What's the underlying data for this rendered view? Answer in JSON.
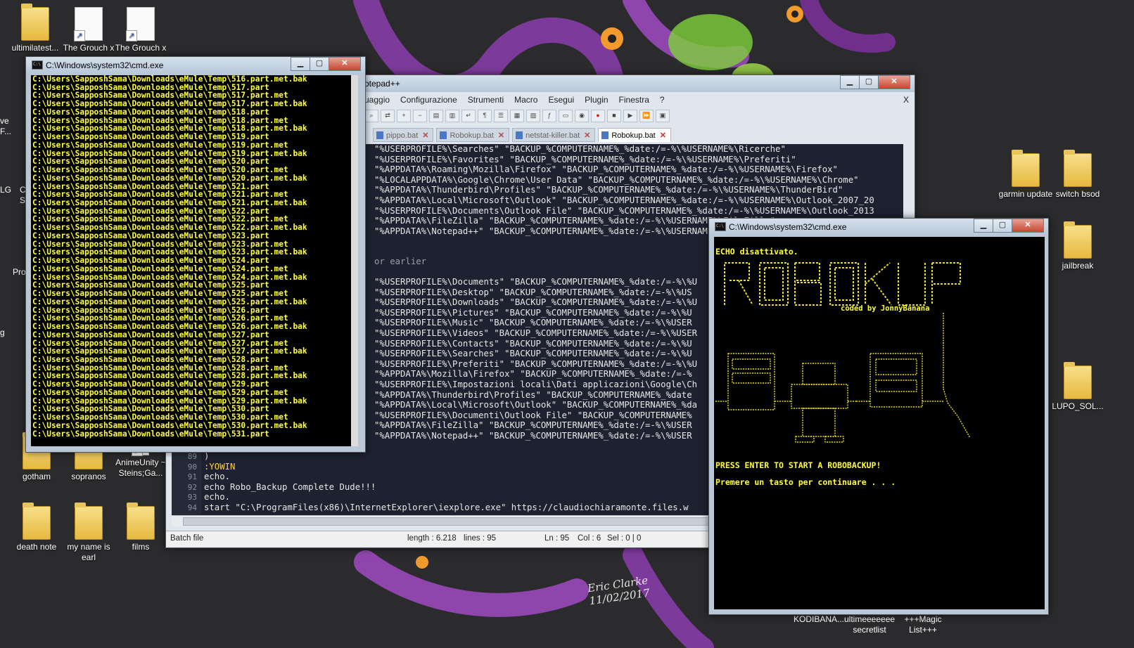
{
  "desktop": {
    "icons_left": [
      {
        "label": "ultimilatest...",
        "type": "folder"
      },
      {
        "label": "The Grouch x",
        "type": "doc"
      },
      {
        "label": "The Grouch x",
        "type": "doc"
      },
      {
        "label": "gotham",
        "type": "folder"
      },
      {
        "label": "sopranos",
        "type": "folder"
      },
      {
        "label": "AnimeUnity ~ Steins;Ga...",
        "type": "doc"
      },
      {
        "label": "death note",
        "type": "folder"
      },
      {
        "label": "my name is earl",
        "type": "folder"
      },
      {
        "label": "films",
        "type": "folder"
      }
    ],
    "edge_labels": [
      "ve",
      "F...",
      "LG",
      "C",
      "S",
      "Pro",
      "g"
    ],
    "icons_right": [
      {
        "label": "garmin update",
        "type": "folder"
      },
      {
        "label": "switch bsod",
        "type": "folder"
      },
      {
        "label": "jailbreak",
        "type": "folder"
      },
      {
        "label": "LUPO_SOL...",
        "type": "folder"
      }
    ],
    "bottom_labels": [
      "KODIBANA...",
      "ultimeeeeeee secretlist",
      "+++Magic List+++"
    ],
    "signature": "Eric Clarke 11/02/2017"
  },
  "cmd1": {
    "title": "C:\\Windows\\system32\\cmd.exe",
    "lines": [
      "C:\\Users\\SapposhSama\\Downloads\\eMule\\Temp\\516.part.met.bak",
      "C:\\Users\\SapposhSama\\Downloads\\eMule\\Temp\\517.part",
      "C:\\Users\\SapposhSama\\Downloads\\eMule\\Temp\\517.part.met",
      "C:\\Users\\SapposhSama\\Downloads\\eMule\\Temp\\517.part.met.bak",
      "C:\\Users\\SapposhSama\\Downloads\\eMule\\Temp\\518.part",
      "C:\\Users\\SapposhSama\\Downloads\\eMule\\Temp\\518.part.met",
      "C:\\Users\\SapposhSama\\Downloads\\eMule\\Temp\\518.part.met.bak",
      "C:\\Users\\SapposhSama\\Downloads\\eMule\\Temp\\519.part",
      "C:\\Users\\SapposhSama\\Downloads\\eMule\\Temp\\519.part.met",
      "C:\\Users\\SapposhSama\\Downloads\\eMule\\Temp\\519.part.met.bak",
      "C:\\Users\\SapposhSama\\Downloads\\eMule\\Temp\\520.part",
      "C:\\Users\\SapposhSama\\Downloads\\eMule\\Temp\\520.part.met",
      "C:\\Users\\SapposhSama\\Downloads\\eMule\\Temp\\520.part.met.bak",
      "C:\\Users\\SapposhSama\\Downloads\\eMule\\Temp\\521.part",
      "C:\\Users\\SapposhSama\\Downloads\\eMule\\Temp\\521.part.met",
      "C:\\Users\\SapposhSama\\Downloads\\eMule\\Temp\\521.part.met.bak",
      "C:\\Users\\SapposhSama\\Downloads\\eMule\\Temp\\522.part",
      "C:\\Users\\SapposhSama\\Downloads\\eMule\\Temp\\522.part.met",
      "C:\\Users\\SapposhSama\\Downloads\\eMule\\Temp\\522.part.met.bak",
      "C:\\Users\\SapposhSama\\Downloads\\eMule\\Temp\\523.part",
      "C:\\Users\\SapposhSama\\Downloads\\eMule\\Temp\\523.part.met",
      "C:\\Users\\SapposhSama\\Downloads\\eMule\\Temp\\523.part.met.bak",
      "C:\\Users\\SapposhSama\\Downloads\\eMule\\Temp\\524.part",
      "C:\\Users\\SapposhSama\\Downloads\\eMule\\Temp\\524.part.met",
      "C:\\Users\\SapposhSama\\Downloads\\eMule\\Temp\\524.part.met.bak",
      "C:\\Users\\SapposhSama\\Downloads\\eMule\\Temp\\525.part",
      "C:\\Users\\SapposhSama\\Downloads\\eMule\\Temp\\525.part.met",
      "C:\\Users\\SapposhSama\\Downloads\\eMule\\Temp\\525.part.met.bak",
      "C:\\Users\\SapposhSama\\Downloads\\eMule\\Temp\\526.part",
      "C:\\Users\\SapposhSama\\Downloads\\eMule\\Temp\\526.part.met",
      "C:\\Users\\SapposhSama\\Downloads\\eMule\\Temp\\526.part.met.bak",
      "C:\\Users\\SapposhSama\\Downloads\\eMule\\Temp\\527.part",
      "C:\\Users\\SapposhSama\\Downloads\\eMule\\Temp\\527.part.met",
      "C:\\Users\\SapposhSama\\Downloads\\eMule\\Temp\\527.part.met.bak",
      "C:\\Users\\SapposhSama\\Downloads\\eMule\\Temp\\528.part",
      "C:\\Users\\SapposhSama\\Downloads\\eMule\\Temp\\528.part.met",
      "C:\\Users\\SapposhSama\\Downloads\\eMule\\Temp\\528.part.met.bak",
      "C:\\Users\\SapposhSama\\Downloads\\eMule\\Temp\\529.part",
      "C:\\Users\\SapposhSama\\Downloads\\eMule\\Temp\\529.part.met",
      "C:\\Users\\SapposhSama\\Downloads\\eMule\\Temp\\529.part.met.bak",
      "C:\\Users\\SapposhSama\\Downloads\\eMule\\Temp\\530.part",
      "C:\\Users\\SapposhSama\\Downloads\\eMule\\Temp\\530.part.met",
      "C:\\Users\\SapposhSama\\Downloads\\eMule\\Temp\\530.part.met.bak",
      "C:\\Users\\SapposhSama\\Downloads\\eMule\\Temp\\531.part"
    ]
  },
  "notepad": {
    "title": "otepad++",
    "menu": [
      "uaggio",
      "Configurazione",
      "Strumenti",
      "Macro",
      "Esegui",
      "Plugin",
      "Finestra",
      "?",
      "X"
    ],
    "tabs": [
      {
        "label": "pippo.bat",
        "active": false
      },
      {
        "label": "Robokup.bat",
        "active": false
      },
      {
        "label": "netstat-killer.bat",
        "active": false
      },
      {
        "label": "Robokup.bat",
        "active": true
      }
    ],
    "code_top": [
      "\"%USERPROFILE%\\Searches\" \"BACKUP_%COMPUTERNAME%_%date:/=-%\\%USERNAME%\\Ricerche\"",
      "\"%USERPROFILE%\\Favorites\" \"BACKUP_%COMPUTERNAME%_%date:/=-%\\%USERNAME%\\Preferiti\"",
      "\"%APPDATA%\\Roaming\\Mozilla\\Firefox\" \"BACKUP_%COMPUTERNAME%_%date:/=-%\\%USERNAME%\\Firefox\"",
      "\"%LOCALAPPDATA%\\Google\\Chrome\\User Data\" \"BACKUP_%COMPUTERNAME%_%date:/=-%\\%USERNAME%\\Chrome\"",
      "\"%APPDATA%\\Thunderbird\\Profiles\" \"BACKUP_%COMPUTERNAME%_%date:/=-%\\%USERNAME%\\ThunderBird\"",
      "\"%APPDATA%\\Local\\Microsoft\\Outlook\" \"BACKUP_%COMPUTERNAME%_%date:/=-%\\%USERNAME%\\Outlook_2007_20",
      "\"%USERPROFILE%\\Documents\\Outlook File\" \"BACKUP_%COMPUTERNAME%_%date:/=-%\\%USERNAME%\\Outlook_2013",
      "\"%APPDATA%\\FileZilla\" \"BACKUP_%COMPUTERNAME%_%date:/=-%\\%USERNAME%\\FileZilla\"",
      "\"%APPDATA%\\Notepad++\" \"BACKUP_%COMPUTERNAME%_%date:/=-%\\%USERNAME%\\Notepad++\""
    ],
    "code_comment": "or earlier",
    "code_mid": [
      "\"%USERPROFILE%\\Documents\" \"BACKUP_%COMPUTERNAME%_%date:/=-%\\%U",
      "\"%USERPROFILE%\\Desktop\" \"BACKUP_%COMPUTERNAME%_%date:/=-%\\%US",
      "\"%USERPROFILE%\\Downloads\" \"BACKUP_%COMPUTERNAME%_%date:/=-%\\%U",
      "\"%USERPROFILE%\\Pictures\" \"BACKUP_%COMPUTERNAME%_%date:/=-%\\%U",
      "\"%USERPROFILE%\\Music\" \"BACKUP_%COMPUTERNAME%_%date:/=-%\\%USER",
      "\"%USERPROFILE%\\Videos\" \"BACKUP_%COMPUTERNAME%_%date:/=-%\\%USER",
      "\"%USERPROFILE%\\Contacts\" \"BACKUP_%COMPUTERNAME%_%date:/=-%\\%U",
      "\"%USERPROFILE%\\Searches\" \"BACKUP_%COMPUTERNAME%_%date:/=-%\\%U",
      "\"%USERPROFILE%\\Preferiti\" \"BACKUP_%COMPUTERNAME%_%date:/=-%\\%U",
      "\"%APPDATA%\\Mozilla\\Firefox\" \"BACKUP_%COMPUTERNAME%_%date:/=-%",
      "\"%USERPROFILE%\\Impostazioni locali\\Dati applicazioni\\Google\\Ch",
      "\"%APPDATA%\\Thunderbird\\Profiles\" \"BACKUP_%COMPUTERNAME%_%date",
      "\"%APPDATA%\\Local\\Microsoft\\Outlook\" \"BACKUP_%COMPUTERNAME%_%da",
      "\"%USERPROFILE%\\Documenti\\Outlook File\" \"BACKUP_%COMPUTERNAME%",
      "\"%APPDATA%\\FileZilla\" \"BACKUP_%COMPUTERNAME%_%date:/=-%\\%USER",
      "\"%APPDATA%\\Notepad++\" \"BACKUP_%COMPUTERNAME%_%date:/=-%\\%USER"
    ],
    "line_numbers": [
      "89",
      "90",
      "91",
      "92",
      "93",
      "94"
    ],
    "code_bottom": [
      ")",
      ":YOWIN",
      "echo.",
      "echo Robo_Backup Complete Dude!!!",
      "echo.",
      "start \"C:\\ProgramFiles(x86)\\InternetExplorer\\iexplore.exe\" https://claudiochiaramonte.files.w"
    ],
    "status": {
      "type": "Batch file",
      "length": "length : 6.218",
      "lines": "lines : 95",
      "ln": "Ln : 95",
      "col": "Col : 6",
      "sel": "Sel : 0 | 0"
    }
  },
  "cmd2": {
    "title": "C:\\Windows\\system32\\cmd.exe",
    "echo_off": "ECHO disattivato.",
    "coded_by": "coded by JonnyBanana",
    "press_enter": "PRESS ENTER TO START A ROBOBACKUP!",
    "pause_msg": "Premere un tasto per continuare . . ."
  },
  "colors": {
    "console_text": "#ffff3c",
    "editor_bg": "#1e2130",
    "label_yellow": "#ffd23c"
  }
}
